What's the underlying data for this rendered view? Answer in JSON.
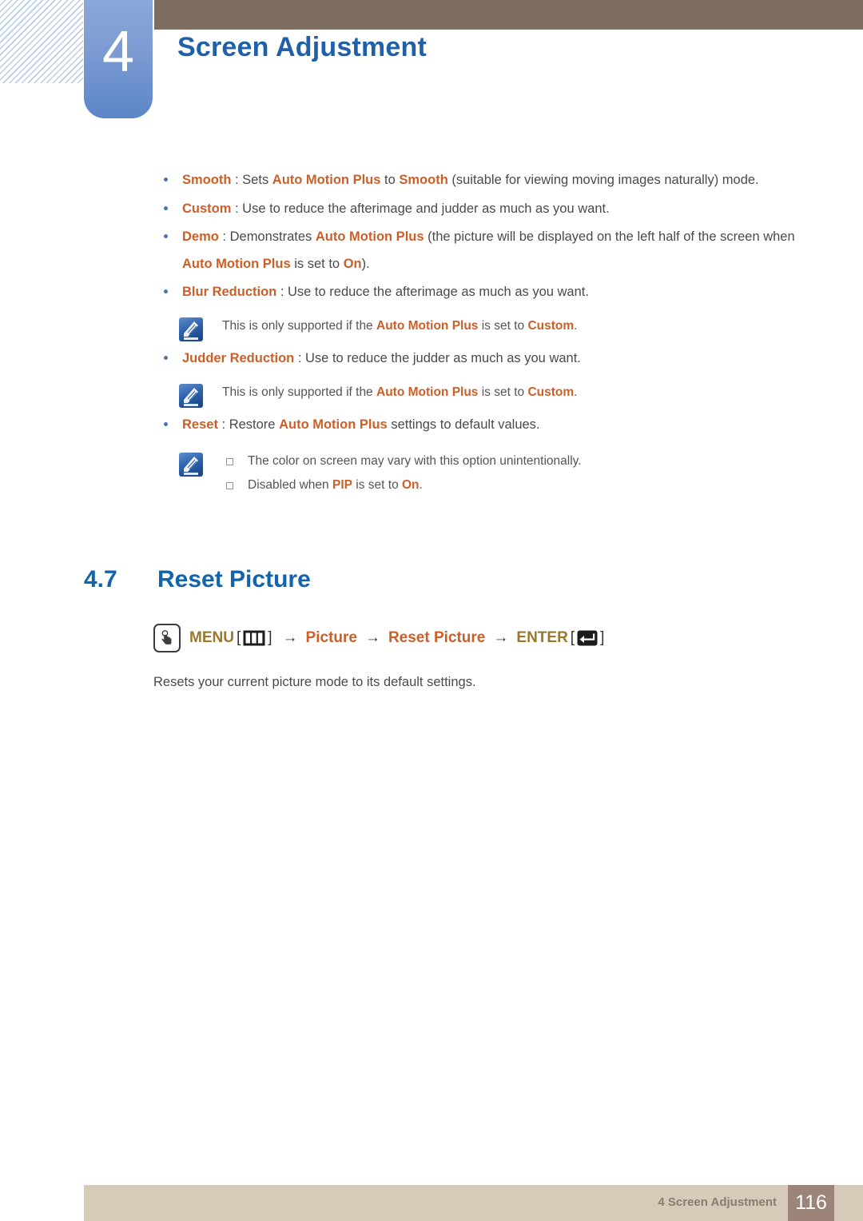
{
  "header": {
    "chapter_number": "4",
    "chapter_title": "Screen Adjustment",
    "accent_blue": "#1f60a8",
    "badge_blue_top": "#8aa7d8",
    "badge_blue_bottom": "#5c86c8",
    "bar_brown": "#7d6e60"
  },
  "bullets": [
    {
      "id": "smooth",
      "segments": [
        {
          "text": "Smooth",
          "style": "keyword"
        },
        {
          "text": " : Sets ",
          "style": "plain"
        },
        {
          "text": "Auto Motion Plus",
          "style": "keyword"
        },
        {
          "text": " to ",
          "style": "plain"
        },
        {
          "text": "Smooth",
          "style": "keyword"
        },
        {
          "text": " (suitable for viewing moving images naturally) mode.",
          "style": "plain"
        }
      ]
    },
    {
      "id": "custom",
      "segments": [
        {
          "text": "Custom",
          "style": "keyword"
        },
        {
          "text": " : Use to reduce the afterimage and judder as much as you want.",
          "style": "plain"
        }
      ]
    },
    {
      "id": "demo",
      "segments": [
        {
          "text": "Demo",
          "style": "keyword"
        },
        {
          "text": " : Demonstrates ",
          "style": "plain"
        },
        {
          "text": "Auto Motion Plus",
          "style": "keyword"
        },
        {
          "text": " (the picture will be displayed on the left half of the screen when ",
          "style": "plain"
        },
        {
          "text": "Auto Motion Plus",
          "style": "keyword"
        },
        {
          "text": " is set to ",
          "style": "plain"
        },
        {
          "text": "On",
          "style": "keyword"
        },
        {
          "text": ").",
          "style": "plain"
        }
      ]
    },
    {
      "id": "blur-reduction",
      "segments": [
        {
          "text": "Blur Reduction",
          "style": "keyword"
        },
        {
          "text": " : Use to reduce the afterimage as much as you want.",
          "style": "plain"
        }
      ]
    },
    {
      "id": "judder-reduction",
      "segments": [
        {
          "text": "Judder Reduction",
          "style": "keyword"
        },
        {
          "text": " : Use to reduce the judder as much as you want.",
          "style": "plain"
        }
      ]
    },
    {
      "id": "reset",
      "segments": [
        {
          "text": "Reset",
          "style": "keyword"
        },
        {
          "text": " : Restore ",
          "style": "plain"
        },
        {
          "text": "Auto Motion Plus",
          "style": "keyword"
        },
        {
          "text": " settings to default values.",
          "style": "plain"
        }
      ]
    }
  ],
  "notes": {
    "blur_note": [
      {
        "text": "This is only supported if the ",
        "style": "plain"
      },
      {
        "text": "Auto Motion Plus",
        "style": "keyword"
      },
      {
        "text": " is set to ",
        "style": "plain"
      },
      {
        "text": "Custom",
        "style": "keyword"
      },
      {
        "text": ".",
        "style": "plain"
      }
    ],
    "judder_note": [
      {
        "text": "This is only supported if the ",
        "style": "plain"
      },
      {
        "text": "Auto Motion Plus",
        "style": "keyword"
      },
      {
        "text": " is set to ",
        "style": "plain"
      },
      {
        "text": "Custom",
        "style": "keyword"
      },
      {
        "text": ".",
        "style": "plain"
      }
    ],
    "reset_note_1": [
      {
        "text": "The color on screen may vary with this option unintentionally.",
        "style": "plain"
      }
    ],
    "reset_note_2": [
      {
        "text": "Disabled when ",
        "style": "plain"
      },
      {
        "text": "PIP",
        "style": "keyword"
      },
      {
        "text": " is set to ",
        "style": "plain"
      },
      {
        "text": "On",
        "style": "keyword"
      },
      {
        "text": ".",
        "style": "plain"
      }
    ]
  },
  "section": {
    "number": "4.7",
    "title": "Reset Picture"
  },
  "menu_path": {
    "menu_label": "MENU",
    "bracket_open": "[",
    "bracket_close": "]",
    "arrow": "→",
    "step_picture": "Picture",
    "step_reset_picture": "Reset Picture",
    "enter_label": "ENTER",
    "hand_icon_name": "hand-press-icon",
    "menu_key_icon_name": "menu-key-icon",
    "enter_key_icon_name": "enter-key-icon"
  },
  "body_text": "Resets your current picture mode to its default settings.",
  "footer": {
    "text": "4 Screen Adjustment",
    "page_number": "116",
    "bar_color": "#d6cab8",
    "page_box_color": "#9c8578"
  },
  "colors": {
    "keyword_orange": "#cc5f28",
    "heading_blue": "#1265ad",
    "menu_gold": "#96792c",
    "body_gray": "#4a4a4a"
  }
}
